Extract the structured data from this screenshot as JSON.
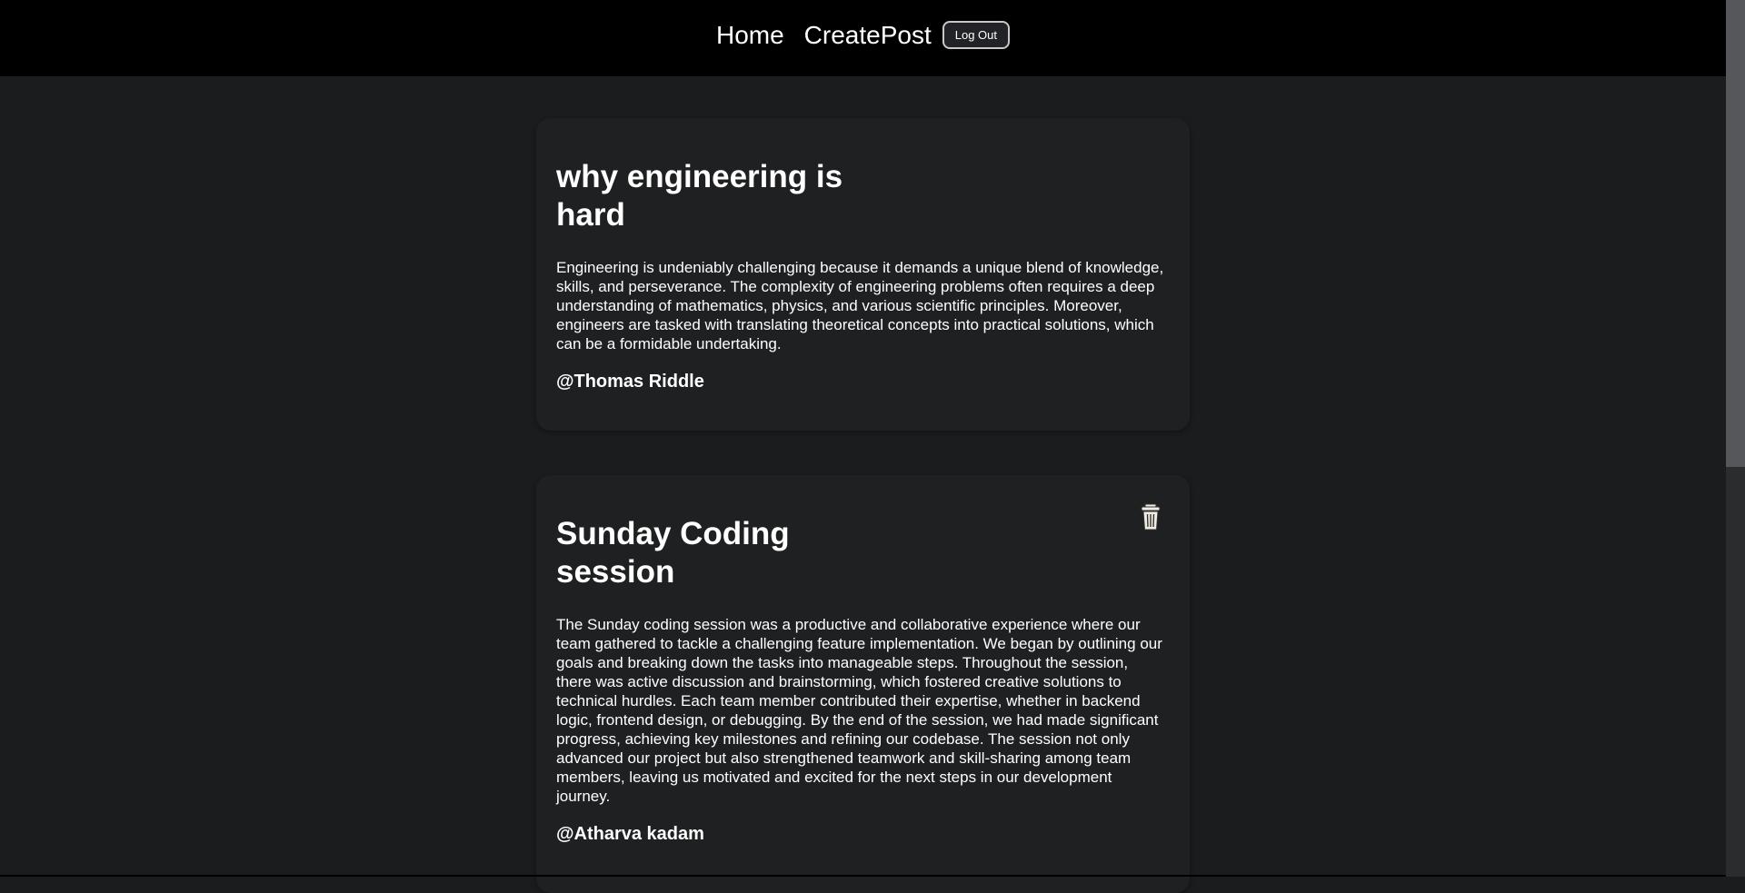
{
  "nav": {
    "home_label": "Home",
    "create_post_label": "CreatePost",
    "logout_label": "Log Out"
  },
  "posts": [
    {
      "title": "why engineering is hard",
      "body": "Engineering is undeniably challenging because it demands a unique blend of knowledge, skills, and perseverance. The complexity of engineering problems often requires a deep understanding of mathematics, physics, and various scientific principles. Moreover, engineers are tasked with translating theoretical concepts into practical solutions, which can be a formidable undertaking.",
      "author": "@Thomas Riddle"
    },
    {
      "title": "Sunday Coding session",
      "body": "The Sunday coding session was a productive and collaborative experience where our team gathered to tackle a challenging feature implementation. We began by outlining our goals and breaking down the tasks into manageable steps. Throughout the session, there was active discussion and brainstorming, which fostered creative solutions to technical hurdles. Each team member contributed their expertise, whether in backend logic, frontend design, or debugging. By the end of the session, we had made significant progress, achieving key milestones and refining our codebase. The session not only advanced our project but also strengthened teamwork and skill-sharing among team members, leaving us motivated and excited for the next steps in our development journey.",
      "author": "@Atharva kadam",
      "delete_icon": "trash-icon"
    }
  ],
  "colors": {
    "navbar_bg": "#000000",
    "page_bg": "#1b1c1e",
    "card_bg": "#1f2022",
    "text": "#ffffff"
  }
}
